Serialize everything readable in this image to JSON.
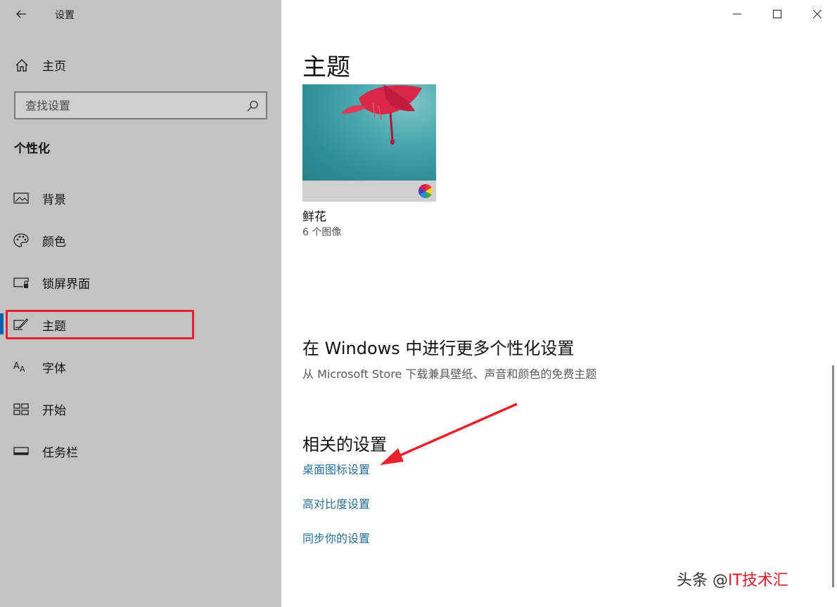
{
  "window": {
    "title": "设置",
    "controls": {
      "minimize": "minimize-icon",
      "maximize": "maximize-icon",
      "close": "close-icon"
    }
  },
  "sidebar": {
    "home_label": "主页",
    "search_placeholder": "查找设置",
    "section_title": "个性化",
    "items": [
      {
        "label": "背景",
        "icon": "picture-icon"
      },
      {
        "label": "颜色",
        "icon": "palette-icon"
      },
      {
        "label": "锁屏界面",
        "icon": "lock-screen-icon"
      },
      {
        "label": "主题",
        "icon": "theme-brush-icon",
        "active": true
      },
      {
        "label": "字体",
        "icon": "font-icon"
      },
      {
        "label": "开始",
        "icon": "start-grid-icon"
      },
      {
        "label": "任务栏",
        "icon": "taskbar-icon"
      }
    ]
  },
  "main": {
    "page_title": "主题",
    "theme": {
      "name": "鲜花",
      "count": "6 个图像"
    },
    "more": {
      "title": "在 Windows 中进行更多个性化设置",
      "description": "从 Microsoft Store 下载兼具壁纸、声音和颜色的免费主题"
    },
    "related": {
      "title": "相关的设置",
      "links": [
        "桌面图标设置",
        "高对比度设置",
        "同步你的设置"
      ]
    }
  },
  "watermark": {
    "prefix": "头条 @",
    "name": "IT技术汇"
  },
  "colors": {
    "accent": "#0063b1",
    "link": "#2a6d97",
    "annotation": "#e8212b",
    "sidebar_bg": "#c3c3c3"
  }
}
